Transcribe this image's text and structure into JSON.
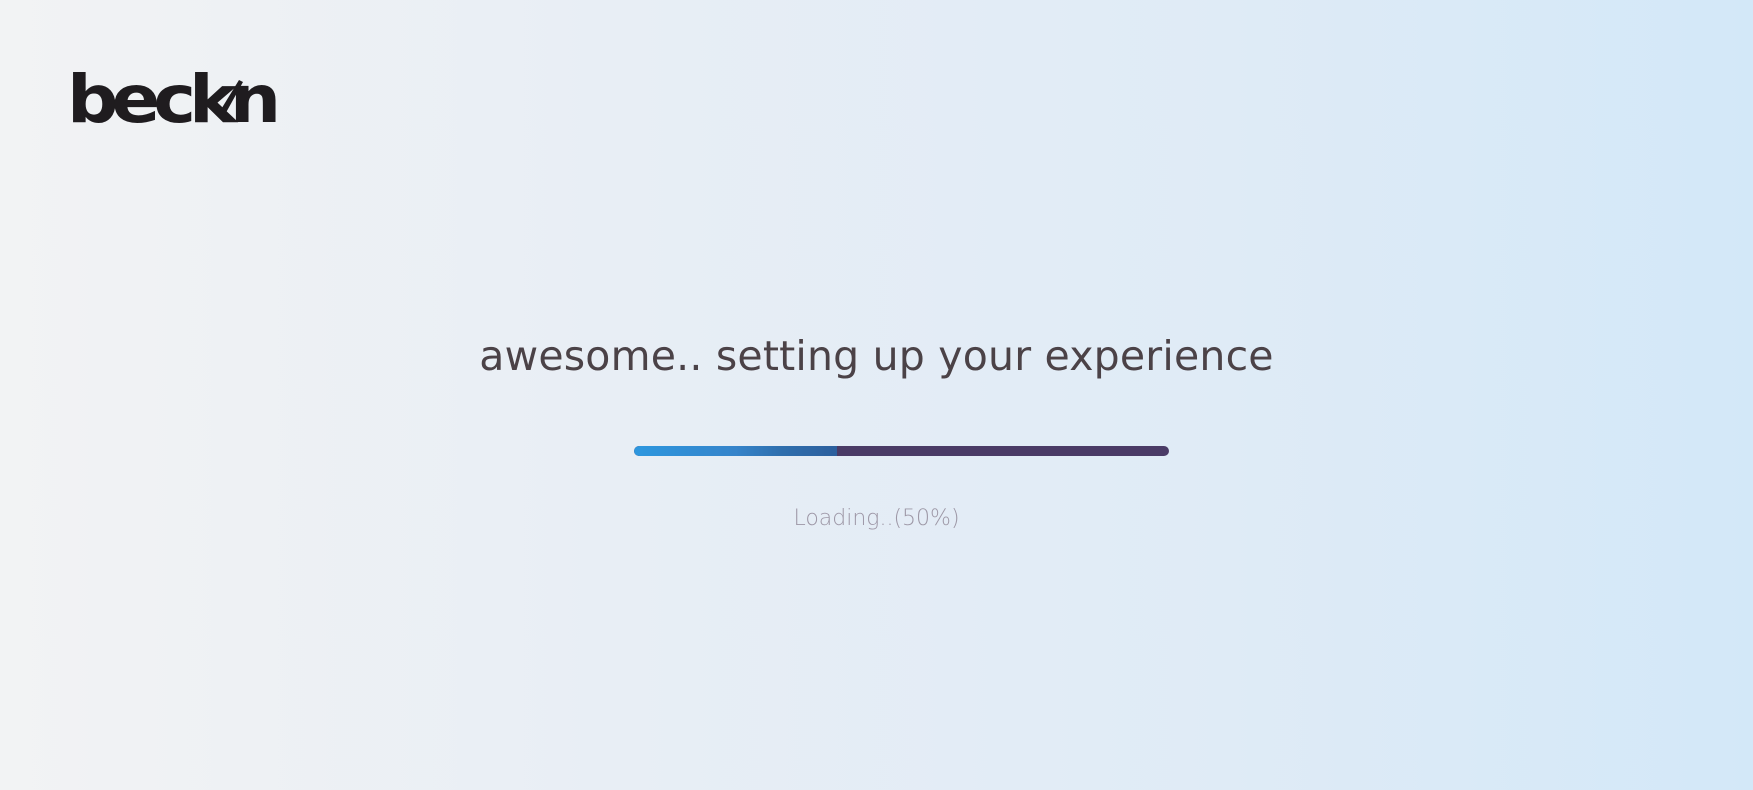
{
  "logo": {
    "text": "beckn",
    "color": "#1f1c1f"
  },
  "headline": "awesome.. setting up your experience",
  "progress": {
    "percent": 0.5,
    "track_color": "#4a3b66",
    "fill_color": "#2d97df",
    "label": "Loading..(50%)"
  }
}
